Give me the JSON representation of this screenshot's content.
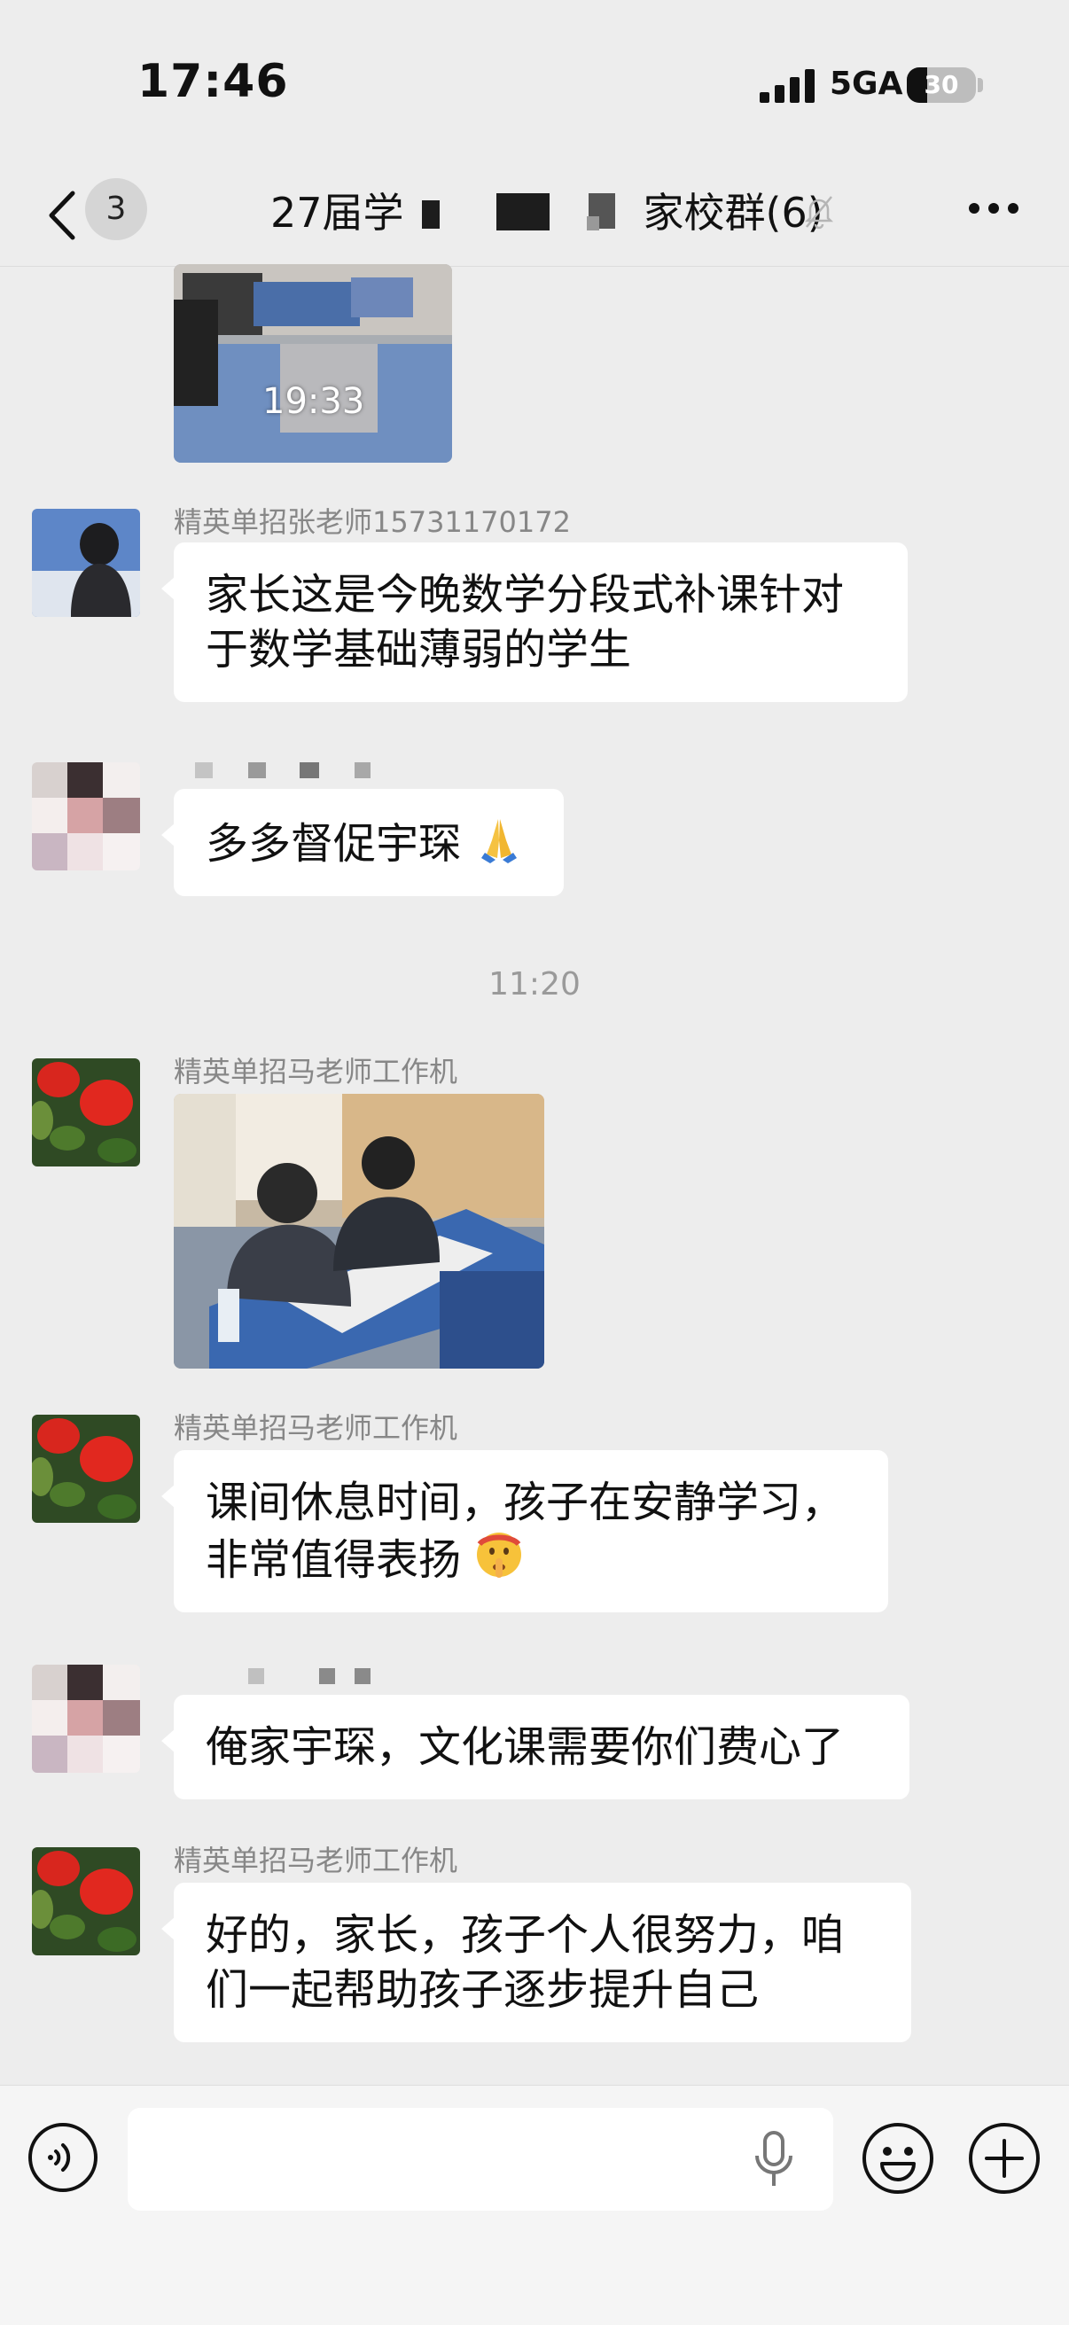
{
  "status_bar": {
    "time": "17:46",
    "network": "5GA",
    "battery": "30",
    "battery_level": 0.3
  },
  "nav": {
    "unread_count": "3",
    "title_prefix": "27届学",
    "title_suffix": "家校群(6)"
  },
  "messages": [
    {
      "type": "image",
      "timestamp_overlay": "19:33"
    },
    {
      "sender": "精英单招张老师15731170172",
      "text": "家长这是今晚数学分段式补课针对于数学基础薄弱的学生"
    },
    {
      "text": "多多督促宇琛",
      "emoji": "folded-hands"
    },
    {
      "time_separator": "11:20"
    },
    {
      "sender": "精英单招马老师工作机",
      "type": "image"
    },
    {
      "sender": "精英单招马老师工作机",
      "text": "课间休息时间，孩子在安静学习，非常值得表扬",
      "emoji": "shushing-face"
    },
    {
      "text": "俺家宇琛，文化课需要你们费心了"
    },
    {
      "sender": "精英单招马老师工作机",
      "text": "好的，家长，孩子个人很努力，咱们一起帮助孩子逐步提升自己"
    }
  ],
  "colors": {
    "background": "#ededed",
    "bubble": "#ffffff",
    "sender_text": "#878787"
  },
  "icons": [
    "back-arrow-icon",
    "mute-bell-icon",
    "more-dots-icon",
    "voice-icon",
    "microphone-icon",
    "emoji-icon",
    "plus-icon"
  ]
}
